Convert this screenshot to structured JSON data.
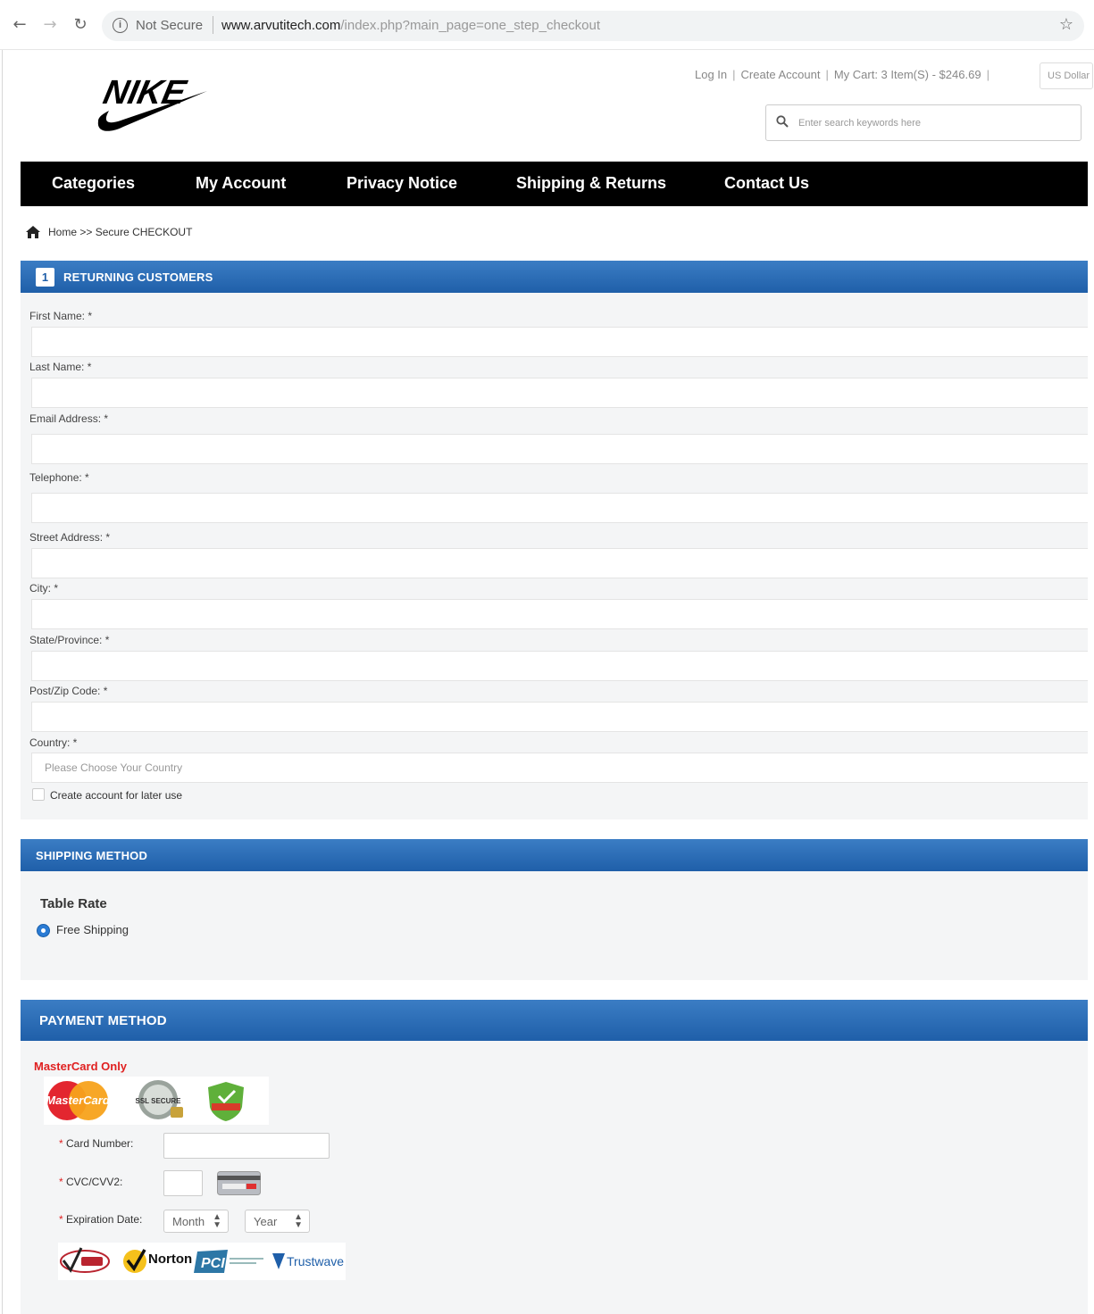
{
  "browser": {
    "security": "Not Secure",
    "url_host": "www.arvutitech.com",
    "url_path": "/index.php?main_page=one_step_checkout"
  },
  "header": {
    "brand": "NIKE",
    "login": "Log In",
    "create_account": "Create Account",
    "cart": "My Cart: 3 Item(S)  -  $246.69",
    "currency": "US Dollar",
    "search_placeholder": "Enter search keywords here"
  },
  "nav": {
    "items": [
      "Categories",
      "My Account",
      "Privacy Notice",
      "Shipping & Returns",
      "Contact Us"
    ]
  },
  "breadcrumb": {
    "home": "Home",
    "separator": ">>",
    "current": "Secure CHECKOUT"
  },
  "returning": {
    "number": "1",
    "title": "RETURNING CUSTOMERS",
    "fields": [
      "First Name: *",
      "Last Name: *",
      "Email Address: *",
      "Telephone: *",
      "Street Address: *",
      "City: *",
      "State/Province: *",
      "Post/Zip Code: *",
      "Country: *"
    ],
    "country_placeholder": "Please Choose Your Country",
    "create_account_label": "Create account for later use"
  },
  "shipping": {
    "title": "SHIPPING METHOD",
    "method": "Table Rate",
    "option": "Free Shipping"
  },
  "payment": {
    "title": "PAYMENT METHOD",
    "notice": "MasterCard Only",
    "card_brand": "MasterCard",
    "ssl_badge": "SSL SECURE",
    "card_number_label": "Card Number:",
    "cvc_label": "CVC/CVV2:",
    "expiration_label": "Expiration Date:",
    "month": "Month",
    "year": "Year",
    "seals": [
      "Norton",
      "PCI",
      "Trustwave"
    ]
  },
  "colors": {
    "section_header": "#1f5fa9",
    "nav_bg": "#000000",
    "required": "#e02020"
  }
}
